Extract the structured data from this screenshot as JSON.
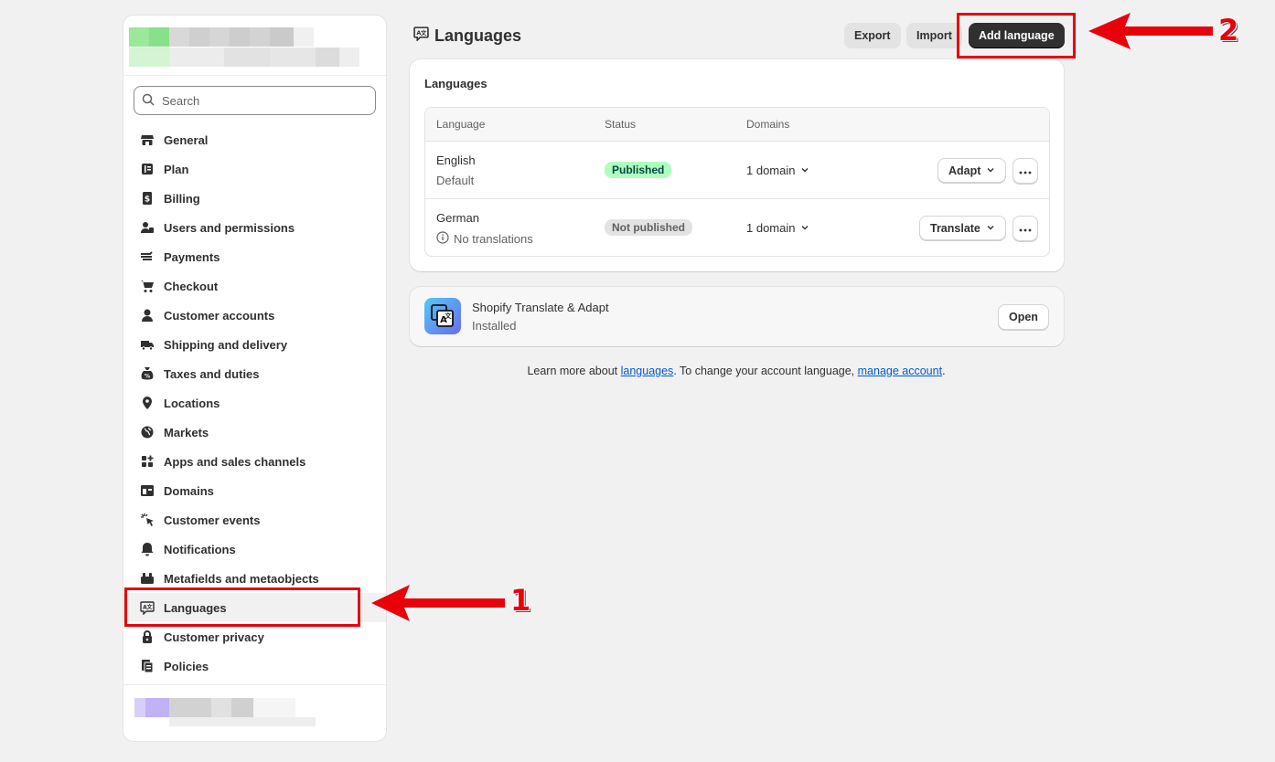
{
  "sidebar": {
    "search_placeholder": "Search",
    "items": [
      {
        "label": "General",
        "icon": "store-icon"
      },
      {
        "label": "Plan",
        "icon": "plan-icon"
      },
      {
        "label": "Billing",
        "icon": "billing-icon"
      },
      {
        "label": "Users and permissions",
        "icon": "users-icon"
      },
      {
        "label": "Payments",
        "icon": "payments-icon"
      },
      {
        "label": "Checkout",
        "icon": "cart-icon"
      },
      {
        "label": "Customer accounts",
        "icon": "person-icon"
      },
      {
        "label": "Shipping and delivery",
        "icon": "truck-icon"
      },
      {
        "label": "Taxes and duties",
        "icon": "tax-bag-icon"
      },
      {
        "label": "Locations",
        "icon": "location-pin-icon"
      },
      {
        "label": "Markets",
        "icon": "globe-icon"
      },
      {
        "label": "Apps and sales channels",
        "icon": "apps-icon"
      },
      {
        "label": "Domains",
        "icon": "domains-icon"
      },
      {
        "label": "Customer events",
        "icon": "cursor-click-icon"
      },
      {
        "label": "Notifications",
        "icon": "bell-icon"
      },
      {
        "label": "Metafields and metaobjects",
        "icon": "metafields-icon"
      },
      {
        "label": "Languages",
        "icon": "language-icon",
        "active": true
      },
      {
        "label": "Customer privacy",
        "icon": "lock-icon"
      },
      {
        "label": "Policies",
        "icon": "policies-icon"
      }
    ]
  },
  "header": {
    "title": "Languages",
    "export_label": "Export",
    "import_label": "Import",
    "add_language_label": "Add language"
  },
  "languages_card": {
    "title": "Languages",
    "columns": [
      "Language",
      "Status",
      "Domains"
    ],
    "rows": [
      {
        "name": "English",
        "sub": "Default",
        "status": "Published",
        "domains": "1 domain",
        "action": "Adapt"
      },
      {
        "name": "German",
        "sub": "No translations",
        "status": "Not published",
        "domains": "1 domain",
        "action": "Translate"
      }
    ]
  },
  "app_card": {
    "name": "Shopify Translate & Adapt",
    "status": "Installed",
    "open_label": "Open"
  },
  "footer": {
    "prefix": "Learn more about ",
    "languages_link": "languages",
    "middle": ". To change your account language, ",
    "account_link": "manage account",
    "suffix": "."
  },
  "annotations": {
    "step1": "1",
    "step2": "2",
    "color": "#e8000b"
  }
}
